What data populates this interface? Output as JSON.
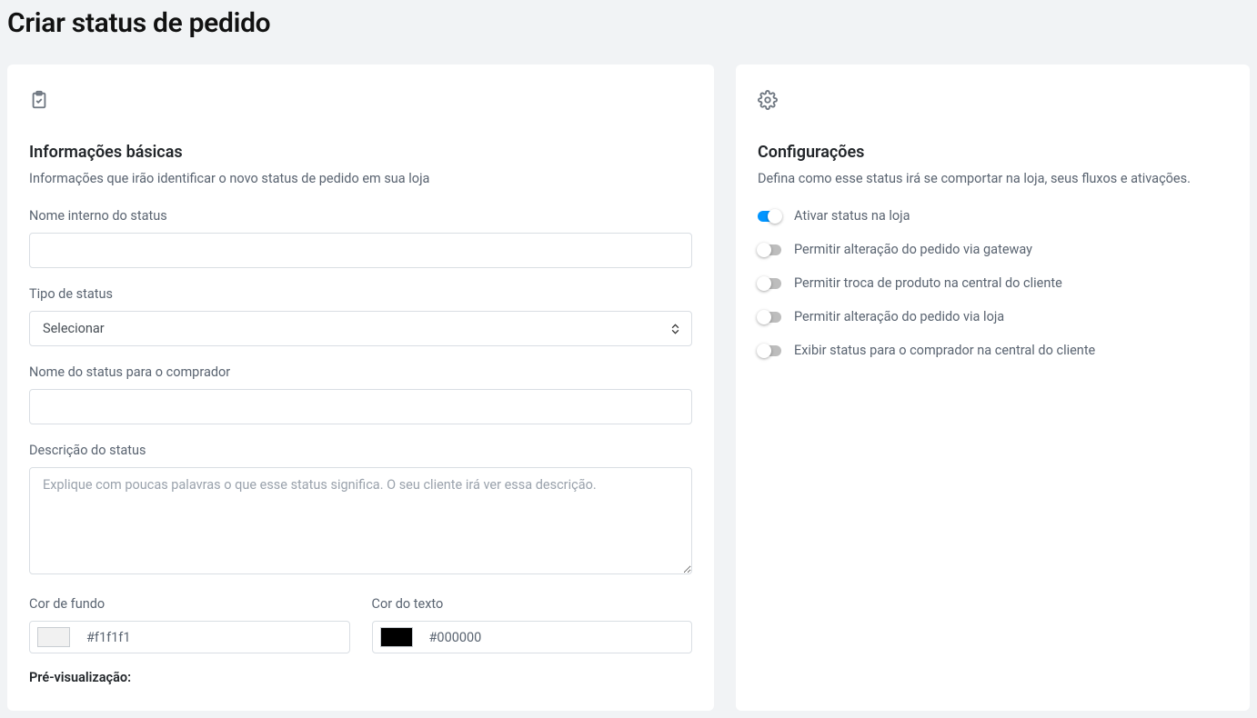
{
  "page_title": "Criar status de pedido",
  "basic_info": {
    "section_title": "Informações básicas",
    "section_subtitle": "Informações que irão identificar o novo status de pedido em sua loja",
    "internal_name_label": "Nome interno do status",
    "internal_name_value": "",
    "type_label": "Tipo de status",
    "type_selected": "Selecionar",
    "buyer_name_label": "Nome do status para o comprador",
    "buyer_name_value": "",
    "description_label": "Descrição do status",
    "description_placeholder": "Explique com poucas palavras o que esse status significa. O seu cliente irá ver essa descrição.",
    "description_value": "",
    "bg_color_label": "Cor de fundo",
    "bg_color_value": "#f1f1f1",
    "text_color_label": "Cor do texto",
    "text_color_value": "#000000",
    "preview_label": "Pré-visualização:"
  },
  "settings": {
    "section_title": "Configurações",
    "section_subtitle": "Defina como esse status irá se comportar na loja, seus fluxos e ativações.",
    "toggles": [
      {
        "label": "Ativar status na loja",
        "on": true
      },
      {
        "label": "Permitir alteração do pedido via gateway",
        "on": false
      },
      {
        "label": "Permitir troca de produto na central do cliente",
        "on": false
      },
      {
        "label": "Permitir alteração do pedido via loja",
        "on": false
      },
      {
        "label": "Exibir status para o comprador na central do cliente",
        "on": false
      }
    ]
  }
}
